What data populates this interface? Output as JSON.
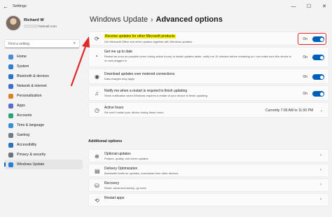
{
  "window": {
    "app_title": "Settings",
    "controls": [
      "—",
      "☐",
      "✕"
    ]
  },
  "profile": {
    "name": "Richard W",
    "email_suffix": "hotmail.com"
  },
  "search": {
    "placeholder": "Find a setting"
  },
  "sidebar": {
    "items": [
      {
        "label": "Home",
        "color": "#4c8bd6"
      },
      {
        "label": "System",
        "color": "#2f7fd1"
      },
      {
        "label": "Bluetooth & devices",
        "color": "#2a73c8"
      },
      {
        "label": "Network & internet",
        "color": "#3b6fd0"
      },
      {
        "label": "Personalization",
        "color": "#d9822b"
      },
      {
        "label": "Apps",
        "color": "#5b6ec7"
      },
      {
        "label": "Accounts",
        "color": "#2aa37a"
      },
      {
        "label": "Time & language",
        "color": "#3b8fd4"
      },
      {
        "label": "Gaming",
        "color": "#6f7b86"
      },
      {
        "label": "Accessibility",
        "color": "#2f6fbf"
      },
      {
        "label": "Privacy & security",
        "color": "#6b7280"
      },
      {
        "label": "Windows Update",
        "color": "#2a7fd4"
      }
    ],
    "active_index": 11
  },
  "breadcrumb": {
    "parent": "Windows Update",
    "separator": "›",
    "current": "Advanced options"
  },
  "options": {
    "receive_updates": {
      "title": "Receive updates for other Microsoft products",
      "description": "Get Microsoft Office and other updates together with Windows updates",
      "state": "On"
    },
    "me_up_to_date": {
      "title": "Get me up to date",
      "description": "Restart as soon as possible (even during active hours) to install updates faster, notify me 15 minutes before restarting so I can make sure this device is on and plugged in",
      "state": "On"
    },
    "metered": {
      "title": "Download updates over metered connections",
      "description": "Data charges may apply",
      "state": "On"
    },
    "notify_restart": {
      "title": "Notify me when a restart is required to finish updating",
      "description": "Show notification when Windows requires a restart of your device to finish updating",
      "state": "On"
    },
    "active_hours": {
      "title": "Active hours",
      "description": "We won't restart your device during these hours",
      "value": "Currently 7:00 AM to 11:00 PM"
    }
  },
  "additional": {
    "heading": "Additional options",
    "items": [
      {
        "title": "Optional updates",
        "description": "Feature, quality, and driver updates"
      },
      {
        "title": "Delivery Optimization",
        "description": "Bandwidth limits for updates, downloads from other devices"
      },
      {
        "title": "Recovery",
        "description": "Reset, advanced startup, go back"
      },
      {
        "title": "Restart apps",
        "description": ""
      }
    ]
  },
  "colors": {
    "accent": "#005fb8",
    "highlight": "#f7f000",
    "annotation": "#e0282a"
  }
}
